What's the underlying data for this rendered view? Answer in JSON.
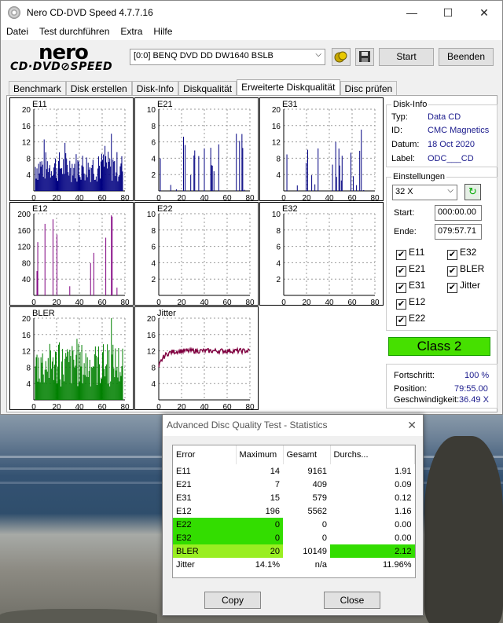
{
  "window": {
    "title": "Nero CD-DVD Speed 4.7.7.16",
    "minimize": "—",
    "maximize": "☐",
    "close": "✕"
  },
  "menu": [
    "Datei",
    "Test durchführen",
    "Extra",
    "Hilfe"
  ],
  "logo": {
    "top": "nero",
    "bottom": "CD·DVD⊘SPEED"
  },
  "toolbar": {
    "drive": "[0:0]   BENQ DVD DD DW1640 BSLB",
    "start_label": "Start",
    "exit_label": "Beenden",
    "eject_icon": "eject-icon",
    "save_icon": "save-icon"
  },
  "tabs": [
    "Benchmark",
    "Disk erstellen",
    "Disk-Info",
    "Diskqualität",
    "Erweiterte Diskqualität",
    "Disc prüfen"
  ],
  "active_tab": "Erweiterte Diskqualität",
  "disk_info": {
    "header": "Disk-Info",
    "type_label": "Typ:",
    "type_value": "Data CD",
    "id_label": "ID:",
    "id_value": "CMC Magnetics",
    "date_label": "Datum:",
    "date_value": "18 Oct 2020",
    "label_label": "Label:",
    "label_value": "ODC___CD"
  },
  "settings": {
    "header": "Einstellungen",
    "speed": "32 X",
    "start_label": "Start:",
    "start_value": "000:00.00",
    "end_label": "Ende:",
    "end_value": "079:57.71",
    "checkboxes": [
      {
        "label": "E11",
        "checked": true
      },
      {
        "label": "E32",
        "checked": true
      },
      {
        "label": "E21",
        "checked": true
      },
      {
        "label": "BLER",
        "checked": true
      },
      {
        "label": "E31",
        "checked": true
      },
      {
        "label": "Jitter",
        "checked": true
      },
      {
        "label": "E12",
        "checked": true
      },
      {
        "label": "E22",
        "checked": true
      }
    ]
  },
  "class_label": "Class 2",
  "progress": {
    "progress_label": "Fortschritt:",
    "progress_value": "100 %",
    "position_label": "Position:",
    "position_value": "79:55.00",
    "speed_label": "Geschwindigkeit:",
    "speed_value": "36.49 X"
  },
  "colors": {
    "e_series": "#000080",
    "e12": "#800080",
    "bler": "#008000",
    "jitter": "#800040",
    "class_box": "#46e000",
    "highlight_green": "#33dd00",
    "highlight_lime": "#99ee22"
  },
  "chart_data": [
    {
      "type": "bar",
      "title": "E11",
      "ylim": [
        0,
        20
      ],
      "yticks": [
        4,
        8,
        12,
        16,
        20
      ],
      "xlim": [
        0,
        80
      ],
      "xticks": [
        0,
        20,
        40,
        60,
        80
      ],
      "grid": true,
      "color": "#000080",
      "profile": "dense",
      "max": 14
    },
    {
      "type": "bar",
      "title": "E21",
      "ylim": [
        0,
        10
      ],
      "yticks": [
        2,
        4,
        6,
        8,
        10
      ],
      "xlim": [
        0,
        80
      ],
      "xticks": [
        0,
        20,
        40,
        60,
        80
      ],
      "grid": true,
      "color": "#000080",
      "profile": "sparse",
      "max": 7
    },
    {
      "type": "bar",
      "title": "E31",
      "ylim": [
        0,
        20
      ],
      "yticks": [
        4,
        8,
        12,
        16,
        20
      ],
      "xlim": [
        0,
        80
      ],
      "xticks": [
        0,
        20,
        40,
        60,
        80
      ],
      "grid": true,
      "color": "#000080",
      "profile": "sparse",
      "max": 15
    },
    {
      "type": "bar",
      "title": "E12",
      "ylim": [
        0,
        200
      ],
      "yticks": [
        40,
        80,
        120,
        160,
        200
      ],
      "xlim": [
        0,
        80
      ],
      "xticks": [
        0,
        20,
        40,
        60,
        80
      ],
      "grid": true,
      "color": "#800080",
      "profile": "spiky",
      "max": 196
    },
    {
      "type": "bar",
      "title": "E22",
      "ylim": [
        0,
        10
      ],
      "yticks": [
        2,
        4,
        6,
        8,
        10
      ],
      "xlim": [
        0,
        80
      ],
      "xticks": [
        0,
        20,
        40,
        60,
        80
      ],
      "grid": true,
      "color": "#000080",
      "profile": "empty",
      "max": 0
    },
    {
      "type": "bar",
      "title": "E32",
      "ylim": [
        0,
        10
      ],
      "yticks": [
        2,
        4,
        6,
        8,
        10
      ],
      "xlim": [
        0,
        80
      ],
      "xticks": [
        0,
        20,
        40,
        60,
        80
      ],
      "grid": true,
      "color": "#000080",
      "profile": "empty",
      "max": 0
    },
    {
      "type": "bar",
      "title": "BLER",
      "ylim": [
        0,
        20
      ],
      "yticks": [
        4,
        8,
        12,
        16,
        20
      ],
      "xlim": [
        0,
        80
      ],
      "xticks": [
        0,
        20,
        40,
        60,
        80
      ],
      "grid": true,
      "color": "#008000",
      "profile": "dense",
      "max": 20
    },
    {
      "type": "line",
      "title": "Jitter",
      "ylim": [
        0,
        20
      ],
      "yticks": [
        4,
        8,
        12,
        16,
        20
      ],
      "xlim": [
        0,
        80
      ],
      "xticks": [
        0,
        20,
        40,
        60,
        80
      ],
      "grid": true,
      "color": "#800040",
      "level": 12,
      "start": 8
    }
  ],
  "dialog": {
    "title": "Advanced Disc Quality Test - Statistics",
    "close": "✕",
    "headers": [
      "Error",
      "Maximum",
      "Gesamt",
      "Durchs..."
    ],
    "rows": [
      {
        "name": "E11",
        "max": "14",
        "total": "9161",
        "avg": "1.91"
      },
      {
        "name": "E21",
        "max": "7",
        "total": "409",
        "avg": "0.09"
      },
      {
        "name": "E31",
        "max": "15",
        "total": "579",
        "avg": "0.12"
      },
      {
        "name": "E12",
        "max": "196",
        "total": "5562",
        "avg": "1.16"
      },
      {
        "name": "E22",
        "max": "0",
        "total": "0",
        "avg": "0.00"
      },
      {
        "name": "E32",
        "max": "0",
        "total": "0",
        "avg": "0.00"
      },
      {
        "name": "BLER",
        "max": "20",
        "total": "10149",
        "avg": "2.12"
      },
      {
        "name": "Jitter",
        "max": "14.1%",
        "total": "n/a",
        "avg": "11.96%"
      }
    ],
    "copy_label": "Copy",
    "close_label": "Close"
  }
}
